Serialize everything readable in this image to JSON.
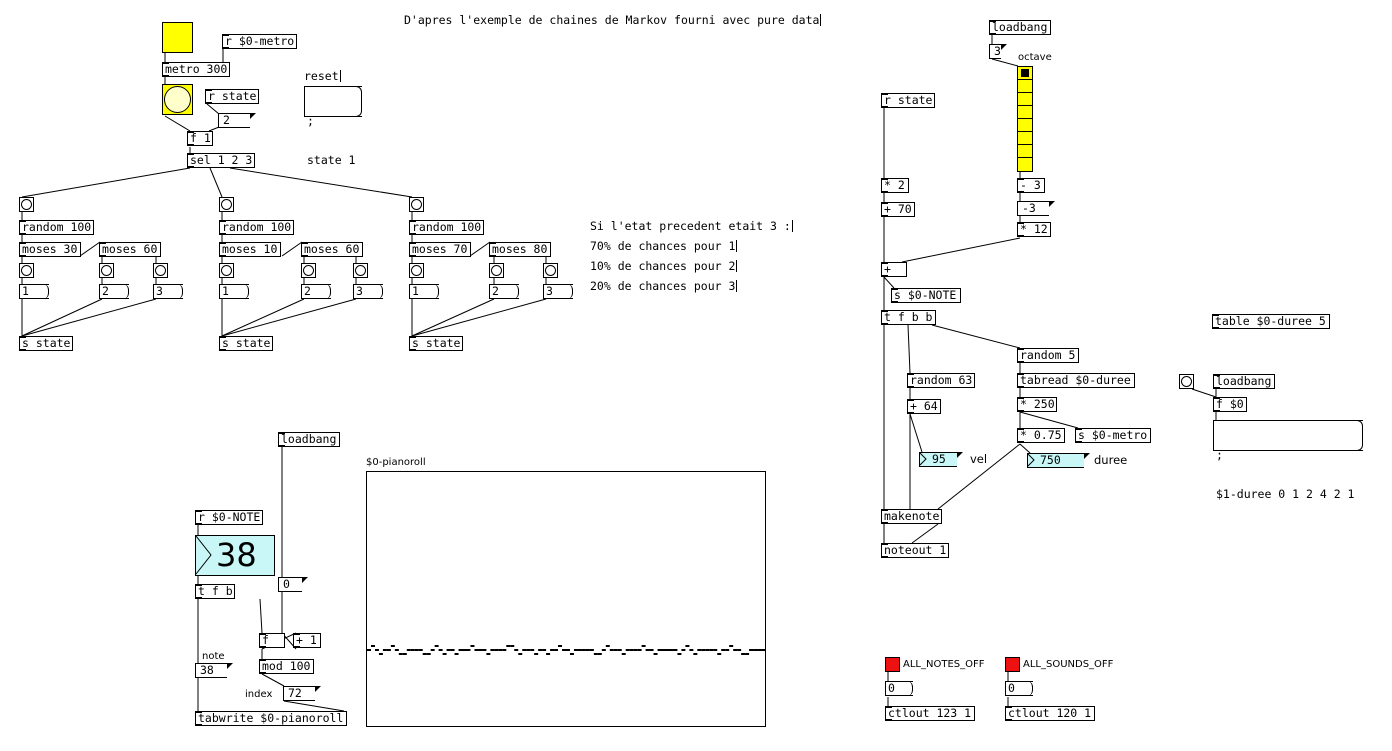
{
  "canvas": {
    "background": "#ffffff",
    "colors": {
      "bang_yellow": "#ffff00",
      "number_cyan": "#c9f7f7",
      "toggle_red": "#ee1111",
      "radio_yellow": "#ffff00"
    }
  },
  "comments": {
    "title": "D'apres l'exemple de chaines de Markov fourni avec pure data",
    "reset": "reset",
    "explain1": "Si l'etat precedent etait 3 :",
    "explain2": "70% de chances pour 1",
    "explain3": "10% de chances pour 2",
    "explain4": "20% de chances pour 3",
    "vel": "vel",
    "duree": "duree",
    "note": "note",
    "index": "index",
    "octave": "octave",
    "pianoroll": "$0-pianoroll"
  },
  "objects": {
    "r_metro": "r $0-metro",
    "metro": "metro 300",
    "r_state_top": "r state",
    "f1": "f 1",
    "sel": "sel 1 2 3",
    "random_a": "random 100",
    "random_b": "random 100",
    "random_c": "random 100",
    "moses_a1": "moses 30",
    "moses_a2": "moses 60",
    "moses_b1": "moses 10",
    "moses_b2": "moses 60",
    "moses_c1": "moses 70",
    "moses_c2": "moses 80",
    "s_state_a": "s state",
    "s_state_b": "s state",
    "s_state_c": "s state",
    "loadbang_piano": "loadbang",
    "r_note": "r $0-NOTE",
    "t_f_b_left": "t f b",
    "f_counter": "f",
    "plus1": "+ 1",
    "mod100": "mod 100",
    "tabwrite": "tabwrite $0-pianoroll",
    "loadbang_oct": "loadbang",
    "r_state_right": "r state",
    "mul2": "* 2",
    "add70": "+ 70",
    "minus3": "- 3",
    "mul12": "* 12",
    "plus": "+",
    "s_note": "s $0-NOTE",
    "t_f_b_b": "t f b b",
    "random5": "random 5",
    "random63": "random 63",
    "tabread": "tabread $0-duree",
    "add64": "+ 64",
    "mul250": "* 250",
    "mul075": "* 0.75",
    "s_metro": "s $0-metro",
    "makenote": "makenote",
    "noteout": "noteout 1",
    "table_duree": "table $0-duree 5",
    "loadbang_duree": "loadbang",
    "f_dollar0": "f $0",
    "ctlout123": "ctlout 123 1",
    "ctlout120": "ctlout 120 1"
  },
  "messages": {
    "reset_msg_line1": ";",
    "reset_msg_line2": "state 1",
    "m1a": "1",
    "m2a": "2",
    "m3a": "3",
    "m1b": "1",
    "m2b": "2",
    "m3b": "3",
    "m1c": "1",
    "m2c": "2",
    "m3c": "3",
    "duree_msg_line1": ";",
    "duree_msg_line2": "$1-duree 0 1 2 4 2 1",
    "all_notes_zero": "0",
    "all_sounds_zero": "0"
  },
  "atoms": {
    "state_num": "2",
    "loadbang_zero": "0",
    "note_num": "38",
    "index_num": "72",
    "oct_three": "3",
    "minus3_out": "-3",
    "vel_num": "95",
    "duree_num": "750",
    "big_note": "38"
  },
  "toggles": {
    "all_notes_off": "ALL_NOTES_OFF",
    "all_sounds_off": "ALL_SOUNDS_OFF"
  },
  "radio": {
    "cells": 8,
    "selected": 0
  },
  "pianoroll": {
    "y_min": 0,
    "y_max": 127,
    "length": 100,
    "values": [
      38,
      40,
      38,
      36,
      38,
      38,
      40,
      38,
      36,
      36,
      38,
      38,
      38,
      38,
      36,
      36,
      38,
      40,
      38,
      36,
      38,
      38,
      36,
      38,
      38,
      38,
      40,
      38,
      38,
      38,
      36,
      38,
      38,
      38,
      38,
      40,
      40,
      38,
      36,
      38,
      38,
      38,
      36,
      38,
      38,
      36,
      38,
      38,
      40,
      38,
      38,
      36,
      38,
      38,
      38,
      38,
      38,
      36,
      36,
      38,
      40,
      38,
      38,
      38,
      36,
      38,
      38,
      38,
      38,
      40,
      38,
      38,
      36,
      38,
      38,
      38,
      38,
      38,
      36,
      38,
      40,
      38,
      36,
      38,
      38,
      38,
      38,
      38,
      36,
      38,
      38,
      40,
      38,
      38,
      36,
      36,
      38,
      38,
      38,
      38
    ]
  }
}
